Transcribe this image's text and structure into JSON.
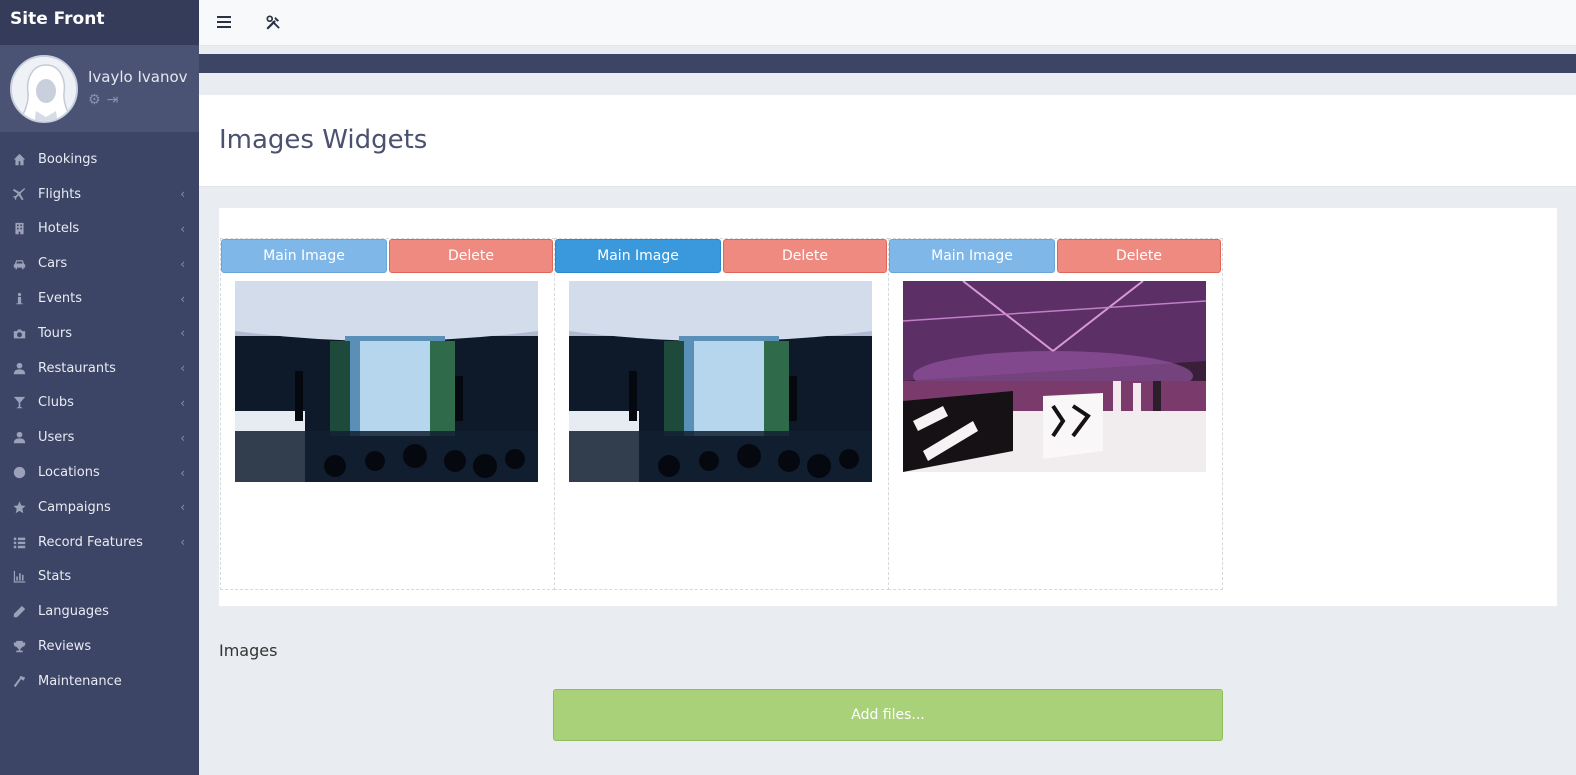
{
  "brand": {
    "title": "Site Front"
  },
  "user": {
    "name": "Ivaylo Ivanov",
    "actions": [
      "gear-icon",
      "sign-out-icon"
    ]
  },
  "sidebar": {
    "items": [
      {
        "label": "Bookings",
        "icon": "home-icon",
        "has_submenu": false
      },
      {
        "label": "Flights",
        "icon": "plane-icon",
        "has_submenu": true
      },
      {
        "label": "Hotels",
        "icon": "building-icon",
        "has_submenu": true
      },
      {
        "label": "Cars",
        "icon": "car-icon",
        "has_submenu": true
      },
      {
        "label": "Events",
        "icon": "info-icon",
        "has_submenu": true
      },
      {
        "label": "Tours",
        "icon": "camera-icon",
        "has_submenu": true
      },
      {
        "label": "Restaurants",
        "icon": "user-icon",
        "has_submenu": true
      },
      {
        "label": "Clubs",
        "icon": "glass-icon",
        "has_submenu": true
      },
      {
        "label": "Users",
        "icon": "user-icon",
        "has_submenu": true
      },
      {
        "label": "Locations",
        "icon": "globe-icon",
        "has_submenu": true
      },
      {
        "label": "Campaigns",
        "icon": "star-icon",
        "has_submenu": true
      },
      {
        "label": "Record Features",
        "icon": "list-icon",
        "has_submenu": true
      },
      {
        "label": "Stats",
        "icon": "chart-icon",
        "has_submenu": false
      },
      {
        "label": "Languages",
        "icon": "pencil-icon",
        "has_submenu": false
      },
      {
        "label": "Reviews",
        "icon": "trophy-icon",
        "has_submenu": false
      },
      {
        "label": "Maintenance",
        "icon": "hammer-icon",
        "has_submenu": false
      }
    ]
  },
  "topbar": {
    "buttons": [
      "menu-icon",
      "tools-icon"
    ]
  },
  "page": {
    "title": "Images Widgets"
  },
  "images": {
    "items": [
      {
        "main_label": "Main Image",
        "delete_label": "Delete",
        "active": false,
        "scene": "fountain-hall"
      },
      {
        "main_label": "Main Image",
        "delete_label": "Delete",
        "active": true,
        "scene": "fountain-hall"
      },
      {
        "main_label": "Main Image",
        "delete_label": "Delete",
        "active": false,
        "scene": "party-hall"
      }
    ],
    "section_label": "Images",
    "add_files_label": "Add files..."
  },
  "colors": {
    "sidebar_bg": "#3d4566",
    "btn_main": "#7fb8e8",
    "btn_main_active": "#3a98dc",
    "btn_delete": "#ef8a80",
    "add_files": "#a9d17a"
  }
}
